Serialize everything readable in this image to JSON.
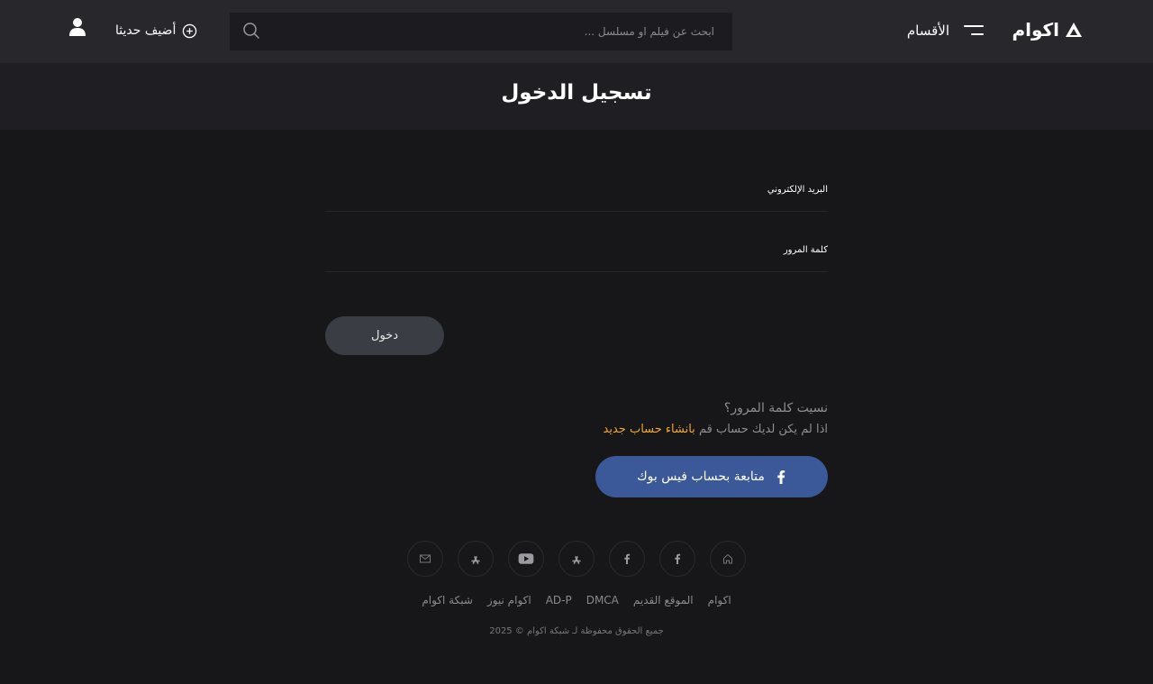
{
  "header": {
    "logo_text": "اكوام",
    "categories_label": "الأقسام",
    "search_placeholder": "ابحث عن فيلم او مسلسل ...",
    "add_recent_label": "أضيف حديثا"
  },
  "page": {
    "title": "تسجيل الدخول"
  },
  "form": {
    "email_label": "البريد الإلكتروني",
    "password_label": "كلمة المرور",
    "login_button": "دخول",
    "forgot_password": "نسيت كلمة المرور؟",
    "register_prefix": "اذا لم يكن لديك حساب قم",
    "register_link": "بانشاء حساب جديد",
    "facebook_button": "متابعة بحساب فيس بوك"
  },
  "footer": {
    "social_icons": [
      "email-icon",
      "app-store-icon",
      "youtube-icon",
      "app-store-icon",
      "facebook-icon",
      "facebook-icon",
      "home-icon"
    ],
    "links": [
      "اكوام",
      "الموقع القديم",
      "DMCA",
      "AD-P",
      "اكوام نيوز",
      "شبكة اكوام"
    ],
    "copyright": "جميع الحقوق محفوظة لـ شبكة اكوام © 2025"
  },
  "colors": {
    "background": "#171719",
    "header": "#27272c",
    "title_bar": "#1f1f23",
    "accent_orange": "#f2a636",
    "facebook_blue": "#3b5998",
    "button_gray": "#3a3d43"
  }
}
